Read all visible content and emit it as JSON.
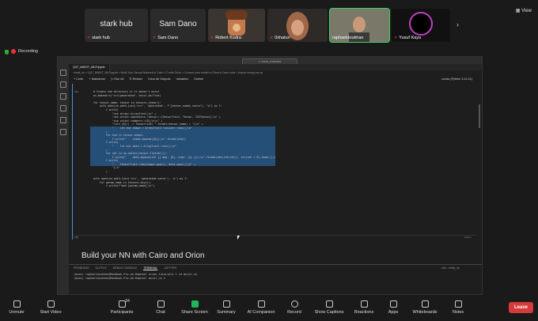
{
  "participants": [
    {
      "name": "stark hub",
      "label": "stark hub",
      "kind": "text"
    },
    {
      "name": "Sam Dano",
      "label": "Sam Dano",
      "kind": "text"
    },
    {
      "name": "Robert Kodra",
      "kind": "video"
    },
    {
      "name": "0xhatun",
      "kind": "video"
    },
    {
      "name": "raphaeldoukhan",
      "kind": "video",
      "active": true
    },
    {
      "name": "Yusuf Kaya",
      "kind": "video"
    }
  ],
  "view_label": "View",
  "recording_label": "Recording",
  "vscode": {
    "window_title": "orion_tutorials",
    "tabs": [
      "Q47_MNIST_MLP.ipynb"
    ],
    "breadcrumb": "mnist_nn > Q47_MNIST_MLP.ipynb > Build Your Neural Network in Cairo 1.0 with Orion > Convert your model to Orion's Cairo code > import numpy as np",
    "toolbar": {
      "code": "+ Code",
      "markdown": "+ Markdown",
      "run_all": "▷ Run All",
      "restart": "↻ Restart",
      "clear_outputs": "Clear All Outputs",
      "variables": "Variables",
      "outline": "Outline",
      "kernel": "conda (Python 3.10.11)"
    },
    "cell_number": "[35]",
    "code_lines": [
      {
        "text": "  # Create the directory if it doesn't exist",
        "sel": false
      },
      {
        "text": "  os.makedirs(\"src/generated\", exist_ok=True)",
        "sel": false
      },
      {
        "text": "",
        "sel": false
      },
      {
        "text": "  for tensor_name, tensor in tensors.items():",
        "sel": false
      },
      {
        "text": "      with open(os.path.join('src', 'generated', f\"{tensor_name}.cairo\"), \"w\") as f:",
        "sel": false
      },
      {
        "text": "          f.write(",
        "sel": false
      },
      {
        "text": "              \"use array::ArrayTrait;\\n\" +",
        "sel": false
      },
      {
        "text": "              \"use orion::operators::tensor::{TensorTrait, Tensor, I32Tensor};\\n\" +",
        "sel": false
      },
      {
        "text": "              \"use orion::numbers::i32;\\n\\n\" +",
        "sel": false
      },
      {
        "text": "              \"\\nfn {0}() -> Tensor<i32> \".format(tensor_name) + \"{\\n\" +",
        "sel": false
      },
      {
        "text": "              \"    let mut shape = ArrayTrait::<usize>::new();\\n\"",
        "sel": true
      },
      {
        "text": "          )",
        "sel": true
      },
      {
        "text": "          for dim in tensor.shape:",
        "sel": true
      },
      {
        "text": "              f.write(\"    shape.append({0});\\n\".format(dim))",
        "sel": true
      },
      {
        "text": "          f.write(",
        "sel": true
      },
      {
        "text": "              \"    let mut data = ArrayTrait::new();\\n\"",
        "sel": true
      },
      {
        "text": "          )",
        "sel": true
      },
      {
        "text": "          for val in np.nditer(tensor.flatten()):",
        "sel": true
      },
      {
        "text": "              f.write(\"    data.append(i32 {{ mag: {0}, sign: {1} }});\\n\".format(abs(int(val)), str(val < 0).lower()))",
        "sel": true
      },
      {
        "text": "          f.write(",
        "sel": true
      },
      {
        "text": "              \"    TensorTrait::new(shape.span(), data.span())\\n\" +",
        "sel": true
      },
      {
        "text": "              \"}\\n\"",
        "sel": false
      },
      {
        "text": "          )",
        "sel": false
      },
      {
        "text": "",
        "sel": false
      },
      {
        "text": "  with open(os.path.join('src', 'generated.cairo'), 'w') as f:",
        "sel": false
      },
      {
        "text": "      for param_name in tensors.keys():",
        "sel": false
      },
      {
        "text": "          f.write(f\"mod {param_name};\\n\")",
        "sel": false
      }
    ],
    "cell_footer": "[35]",
    "cell_language": "Python",
    "markdown_heading": "Build your NN with Cairo and Orion",
    "panel_tabs": [
      "PROBLEMS",
      "OUTPUT",
      "DEBUG CONSOLE",
      "TERMINAL",
      "JUPYTER"
    ],
    "panel_active": "TERMINAL",
    "panel_right": "zsh - mnist_nn",
    "terminal_lines": [
      "(base) raphaeldoukhan@MacBook-Pro-de-Raphael orion_tutorials % cd mnist_nn",
      "(base) raphaeldoukhan@MacBook-Pro-de-Raphael mnist_nn % "
    ]
  },
  "zoom_toolbar": [
    {
      "label": "Unmute",
      "icon": "microphone-muted-icon"
    },
    {
      "label": "Start Video",
      "icon": "video-off-icon"
    },
    {
      "label": "Participants",
      "icon": "participants-icon",
      "count": "34"
    },
    {
      "label": "Chat",
      "icon": "chat-icon"
    },
    {
      "label": "Share Screen",
      "icon": "share-screen-icon"
    },
    {
      "label": "Summary",
      "icon": "summary-icon"
    },
    {
      "label": "AI Companion",
      "icon": "ai-companion-icon"
    },
    {
      "label": "Record",
      "icon": "record-icon"
    },
    {
      "label": "Show Captions",
      "icon": "captions-icon"
    },
    {
      "label": "Reactions",
      "icon": "reactions-icon"
    },
    {
      "label": "Apps",
      "icon": "apps-icon"
    },
    {
      "label": "Whiteboards",
      "icon": "whiteboard-icon"
    },
    {
      "label": "Notes",
      "icon": "notes-icon"
    }
  ],
  "leave_label": "Leave",
  "colors": {
    "accent_green": "#1db954",
    "leave_red": "#d63b3b",
    "selection": "#264f78"
  }
}
